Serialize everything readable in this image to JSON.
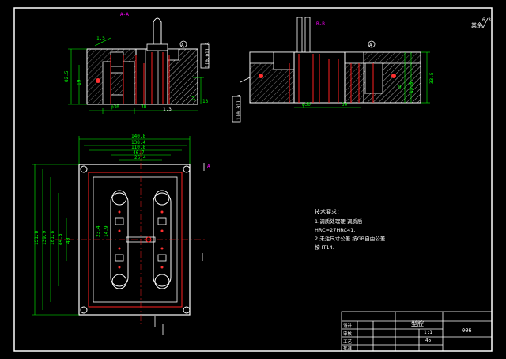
{
  "section_labels": {
    "left": "A-A",
    "right": "B-B"
  },
  "roughness": {
    "symbol": "6.3",
    "note": "其余"
  },
  "section_marker": "A",
  "left_view_dims": {
    "top": "1.5",
    "left_height": "82.5",
    "left_inner": "19",
    "bottom_a": "φ30",
    "bottom_b": "30",
    "right_a": "14",
    "right_b": "13",
    "tag": "1(0.01) A",
    "bottom_c": "1.3"
  },
  "right_view_dims": {
    "right_a": "33.5",
    "right_b": "13.5",
    "right_c": "9",
    "bottom_a": "φ30",
    "bottom_b": "30",
    "tag": "1(0.01) A"
  },
  "plan_dims": {
    "width_1": "140.8",
    "width_2": "138.4",
    "width_3": "110.8",
    "width_4": "46.7",
    "width_5": "26.4",
    "height_1": "151.8",
    "height_2": "139.9",
    "height_3": "101.8",
    "height_4": "84.8",
    "height_5": "40",
    "center_1": "23.4",
    "center_2": "14.9"
  },
  "tech_requirements": {
    "title": "技术要求：",
    "items": [
      "1.调质处理硬 调质后",
      "HRC=27HRC41.",
      "2.未注尺寸公差 按GB自由公差",
      "按 IT14."
    ]
  },
  "title_block": {
    "drawing_name": "型腔",
    "drawing_no": "006",
    "material": "45",
    "scale": "1:1",
    "rows": [
      "设计",
      "审核",
      "工艺",
      "批准"
    ]
  }
}
